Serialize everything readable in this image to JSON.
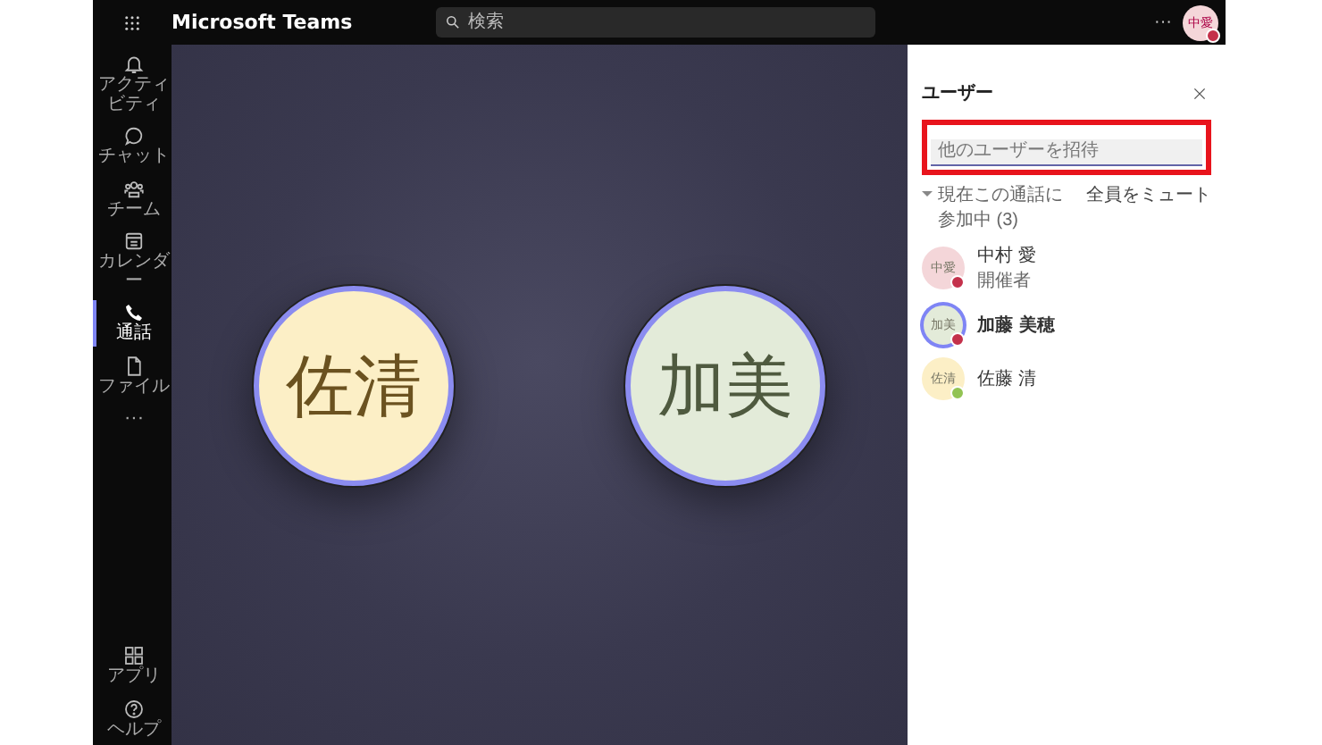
{
  "app": {
    "title": "Microsoft Teams",
    "search": {
      "placeholder": "検索"
    },
    "more": "···",
    "me": {
      "initials": "中愛",
      "color": "#c4314b"
    }
  },
  "rail": [
    {
      "kind": "bell",
      "label": "アクティビティ",
      "selected": false
    },
    {
      "kind": "chat",
      "label": "チャット",
      "selected": false
    },
    {
      "kind": "team",
      "label": "チーム",
      "selected": false
    },
    {
      "kind": "calendar",
      "label": "カレンダー",
      "selected": false
    },
    {
      "kind": "phone",
      "label": "通話",
      "selected": true
    },
    {
      "kind": "file",
      "label": "ファイル",
      "selected": false
    },
    {
      "kind": "more",
      "label": "···",
      "selected": false
    }
  ],
  "rail_bottom": [
    {
      "kind": "apps",
      "label": "アプリ"
    },
    {
      "kind": "help",
      "label": "ヘルプ"
    }
  ],
  "stage": [
    {
      "initials": "佐清",
      "color": "#fcefc6"
    },
    {
      "initials": "加美",
      "color": "#e3ebd9"
    }
  ],
  "panel": {
    "title": "ユーザー",
    "invite": {
      "placeholder": "他のユーザーを招待",
      "highlighted": true
    },
    "section": {
      "label": "現在この通話に参加中 (3)",
      "expanded": true,
      "action": "全員をミュート"
    },
    "people": [
      {
        "avatar": {
          "initials": "中愛",
          "color": "#f4d6d9"
        },
        "name": "中村 愛",
        "role": "開催者",
        "status": {
          "color": "#c4314b"
        },
        "speaking": false
      },
      {
        "avatar": {
          "initials": "加美",
          "color": "#e3ebd9"
        },
        "name": "加藤 美穂",
        "status": {
          "color": "#c4314b"
        },
        "speaking": true
      },
      {
        "avatar": {
          "initials": "佐清",
          "color": "#fcefc6"
        },
        "name": "佐藤 清",
        "status": {
          "color": "#92c353"
        },
        "speaking": false
      }
    ]
  }
}
